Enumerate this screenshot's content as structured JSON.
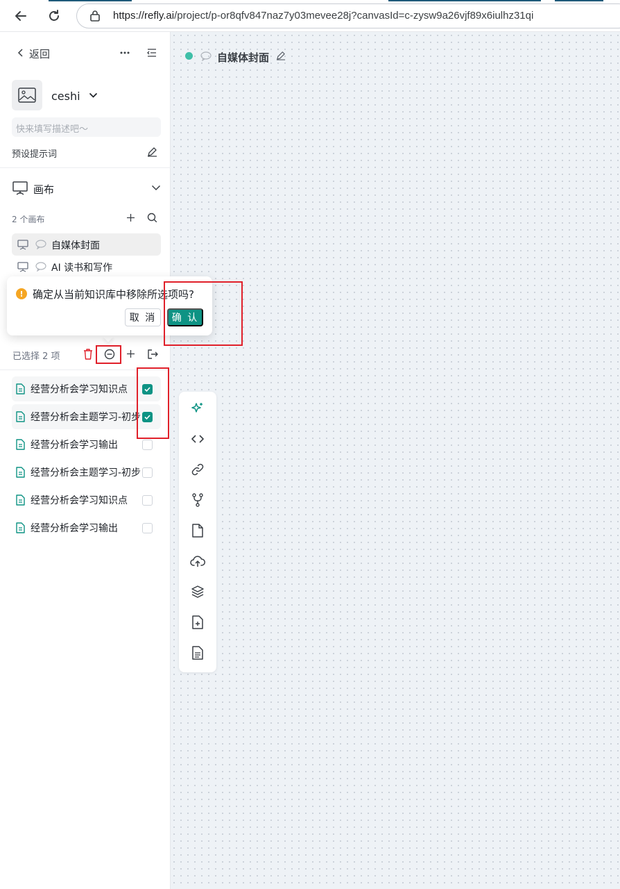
{
  "browser": {
    "url_host": "https://refly.ai",
    "url_path": "/project/p-or8qfv847naz7y03mevee28j?canvasId=c-zysw9a26vjf89x6iulhz31qi"
  },
  "sidebar": {
    "back_label": "返回",
    "project_name": "ceshi",
    "description_placeholder": "快来填写描述吧～",
    "preset_prompt_label": "预设提示词",
    "canvas_section_label": "画布",
    "canvas_count": "2 个画布",
    "canvases": [
      {
        "label": "自媒体封面",
        "active": true
      },
      {
        "label": "AI 读书和写作",
        "active": false
      }
    ],
    "selected_count": "已选择 2 项",
    "documents": [
      {
        "label": "经营分析会学习知识点",
        "checked": true
      },
      {
        "label": "经营分析会主题学习-初步",
        "checked": true
      },
      {
        "label": "经营分析会学习输出",
        "checked": false
      },
      {
        "label": "经营分析会主题学习-初步",
        "checked": false
      },
      {
        "label": "经营分析会学习知识点",
        "checked": false
      },
      {
        "label": "经营分析会学习输出",
        "checked": false
      }
    ]
  },
  "canvas": {
    "title": "自媒体封面"
  },
  "popconfirm": {
    "message": "确定从当前知识库中移除所选项吗?",
    "cancel_label": "取 消",
    "confirm_label": "确 认"
  },
  "colors": {
    "accent": "#0e9384",
    "warning": "#f5a623",
    "danger": "#e0202a",
    "status_dot": "#3fbfa8"
  },
  "toolbar_icons": [
    "sparkles-icon",
    "code-icon",
    "link-icon",
    "branch-icon",
    "file-icon",
    "cloud-upload-icon",
    "layers-icon",
    "file-plus-icon",
    "file-text-icon"
  ]
}
